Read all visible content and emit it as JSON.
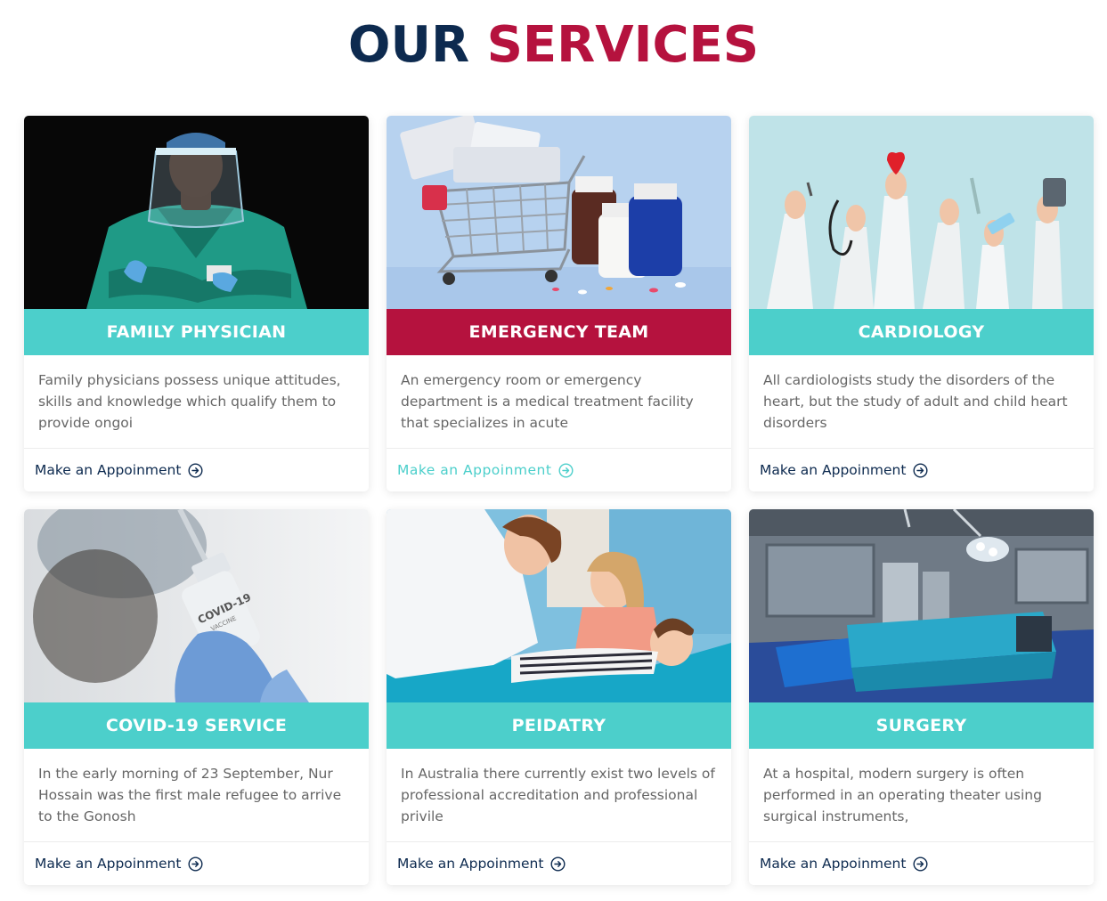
{
  "header": {
    "title_part1": "OUR",
    "title_part2": "SERVICES"
  },
  "colors": {
    "navy": "#0d2a4f",
    "crimson": "#b5123e",
    "teal": "#4ccfcb"
  },
  "cards": [
    {
      "title": "FAMILY PHYSICIAN",
      "text": "Family physicians possess unique attitudes, skills and knowledge which qualify them to provide ongoi",
      "link": "Make an Appoinment",
      "image": "doctor-with-face-shield"
    },
    {
      "title": "EMERGENCY TEAM",
      "text": "An emergency room or emergency department is a medical treatment facility that specializes in acute",
      "link": "Make an Appoinment",
      "image": "pills-shopping-cart"
    },
    {
      "title": "CARDIOLOGY",
      "text": "All cardiologists study the disorders of the heart, but the study of adult and child heart disorders",
      "link": "Make an Appoinment",
      "image": "hands-with-medical-items"
    },
    {
      "title": "COVID-19 SERVICE",
      "text": "In the early morning of 23 September, Nur Hossain was the first male refugee to arrive to the Gonosh",
      "link": "Make an Appoinment",
      "image": "covid-vaccine-vial",
      "vial_text": "COVID-19",
      "vial_sub": "VACCINE"
    },
    {
      "title": "PEIDATRY",
      "text": "In Australia there currently exist two levels of professional accreditation and professional privile",
      "link": "Make an Appoinment",
      "image": "pediatric-checkup"
    },
    {
      "title": "SURGERY",
      "text": "At a hospital, modern surgery is often performed in an operating theater using surgical instruments,",
      "link": "Make an Appoinment",
      "image": "operating-room"
    }
  ]
}
